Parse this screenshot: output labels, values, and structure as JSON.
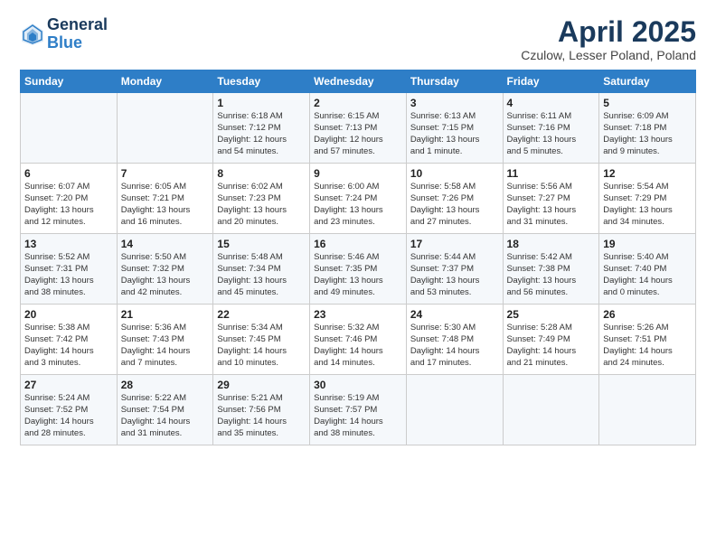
{
  "header": {
    "logo_line1": "General",
    "logo_line2": "Blue",
    "main_title": "April 2025",
    "subtitle": "Czulow, Lesser Poland, Poland"
  },
  "days_of_week": [
    "Sunday",
    "Monday",
    "Tuesday",
    "Wednesday",
    "Thursday",
    "Friday",
    "Saturday"
  ],
  "weeks": [
    [
      {
        "day": "",
        "detail": ""
      },
      {
        "day": "",
        "detail": ""
      },
      {
        "day": "1",
        "detail": "Sunrise: 6:18 AM\nSunset: 7:12 PM\nDaylight: 12 hours\nand 54 minutes."
      },
      {
        "day": "2",
        "detail": "Sunrise: 6:15 AM\nSunset: 7:13 PM\nDaylight: 12 hours\nand 57 minutes."
      },
      {
        "day": "3",
        "detail": "Sunrise: 6:13 AM\nSunset: 7:15 PM\nDaylight: 13 hours\nand 1 minute."
      },
      {
        "day": "4",
        "detail": "Sunrise: 6:11 AM\nSunset: 7:16 PM\nDaylight: 13 hours\nand 5 minutes."
      },
      {
        "day": "5",
        "detail": "Sunrise: 6:09 AM\nSunset: 7:18 PM\nDaylight: 13 hours\nand 9 minutes."
      }
    ],
    [
      {
        "day": "6",
        "detail": "Sunrise: 6:07 AM\nSunset: 7:20 PM\nDaylight: 13 hours\nand 12 minutes."
      },
      {
        "day": "7",
        "detail": "Sunrise: 6:05 AM\nSunset: 7:21 PM\nDaylight: 13 hours\nand 16 minutes."
      },
      {
        "day": "8",
        "detail": "Sunrise: 6:02 AM\nSunset: 7:23 PM\nDaylight: 13 hours\nand 20 minutes."
      },
      {
        "day": "9",
        "detail": "Sunrise: 6:00 AM\nSunset: 7:24 PM\nDaylight: 13 hours\nand 23 minutes."
      },
      {
        "day": "10",
        "detail": "Sunrise: 5:58 AM\nSunset: 7:26 PM\nDaylight: 13 hours\nand 27 minutes."
      },
      {
        "day": "11",
        "detail": "Sunrise: 5:56 AM\nSunset: 7:27 PM\nDaylight: 13 hours\nand 31 minutes."
      },
      {
        "day": "12",
        "detail": "Sunrise: 5:54 AM\nSunset: 7:29 PM\nDaylight: 13 hours\nand 34 minutes."
      }
    ],
    [
      {
        "day": "13",
        "detail": "Sunrise: 5:52 AM\nSunset: 7:31 PM\nDaylight: 13 hours\nand 38 minutes."
      },
      {
        "day": "14",
        "detail": "Sunrise: 5:50 AM\nSunset: 7:32 PM\nDaylight: 13 hours\nand 42 minutes."
      },
      {
        "day": "15",
        "detail": "Sunrise: 5:48 AM\nSunset: 7:34 PM\nDaylight: 13 hours\nand 45 minutes."
      },
      {
        "day": "16",
        "detail": "Sunrise: 5:46 AM\nSunset: 7:35 PM\nDaylight: 13 hours\nand 49 minutes."
      },
      {
        "day": "17",
        "detail": "Sunrise: 5:44 AM\nSunset: 7:37 PM\nDaylight: 13 hours\nand 53 minutes."
      },
      {
        "day": "18",
        "detail": "Sunrise: 5:42 AM\nSunset: 7:38 PM\nDaylight: 13 hours\nand 56 minutes."
      },
      {
        "day": "19",
        "detail": "Sunrise: 5:40 AM\nSunset: 7:40 PM\nDaylight: 14 hours\nand 0 minutes."
      }
    ],
    [
      {
        "day": "20",
        "detail": "Sunrise: 5:38 AM\nSunset: 7:42 PM\nDaylight: 14 hours\nand 3 minutes."
      },
      {
        "day": "21",
        "detail": "Sunrise: 5:36 AM\nSunset: 7:43 PM\nDaylight: 14 hours\nand 7 minutes."
      },
      {
        "day": "22",
        "detail": "Sunrise: 5:34 AM\nSunset: 7:45 PM\nDaylight: 14 hours\nand 10 minutes."
      },
      {
        "day": "23",
        "detail": "Sunrise: 5:32 AM\nSunset: 7:46 PM\nDaylight: 14 hours\nand 14 minutes."
      },
      {
        "day": "24",
        "detail": "Sunrise: 5:30 AM\nSunset: 7:48 PM\nDaylight: 14 hours\nand 17 minutes."
      },
      {
        "day": "25",
        "detail": "Sunrise: 5:28 AM\nSunset: 7:49 PM\nDaylight: 14 hours\nand 21 minutes."
      },
      {
        "day": "26",
        "detail": "Sunrise: 5:26 AM\nSunset: 7:51 PM\nDaylight: 14 hours\nand 24 minutes."
      }
    ],
    [
      {
        "day": "27",
        "detail": "Sunrise: 5:24 AM\nSunset: 7:52 PM\nDaylight: 14 hours\nand 28 minutes."
      },
      {
        "day": "28",
        "detail": "Sunrise: 5:22 AM\nSunset: 7:54 PM\nDaylight: 14 hours\nand 31 minutes."
      },
      {
        "day": "29",
        "detail": "Sunrise: 5:21 AM\nSunset: 7:56 PM\nDaylight: 14 hours\nand 35 minutes."
      },
      {
        "day": "30",
        "detail": "Sunrise: 5:19 AM\nSunset: 7:57 PM\nDaylight: 14 hours\nand 38 minutes."
      },
      {
        "day": "",
        "detail": ""
      },
      {
        "day": "",
        "detail": ""
      },
      {
        "day": "",
        "detail": ""
      }
    ]
  ]
}
